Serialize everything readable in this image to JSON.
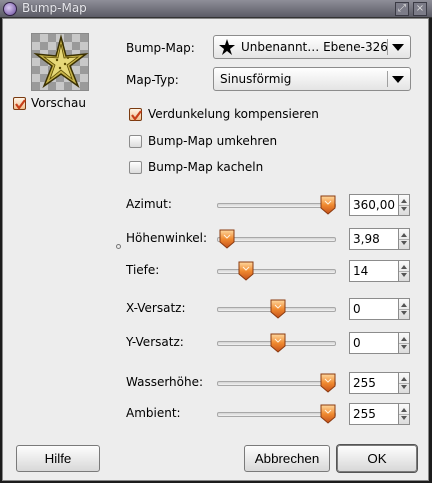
{
  "window": {
    "title": "Bump-Map",
    "accent": "#e8821e"
  },
  "preview": {
    "label": "Vorschau",
    "checked": true
  },
  "bump_map": {
    "label": "Bump-Map:",
    "value": "Unbenannt… Ebene-326"
  },
  "map_type": {
    "label": "Map-Typ:",
    "value": "Sinusförmig"
  },
  "options": [
    {
      "label": "Verdunkelung kompensieren",
      "checked": true
    },
    {
      "label": "Bump-Map umkehren",
      "checked": false
    },
    {
      "label": "Bump-Map kacheln",
      "checked": false
    }
  ],
  "sliders": [
    {
      "label": "Azimut:",
      "value": "360,00",
      "fraction": 1.0
    },
    {
      "label": "Höhenwinkel:",
      "value": "3,98",
      "fraction": 0.0
    },
    {
      "label": "Tiefe:",
      "value": "14",
      "fraction": 0.19
    },
    {
      "label": "X-Versatz:",
      "value": "0",
      "fraction": 0.5
    },
    {
      "label": "Y-Versatz:",
      "value": "0",
      "fraction": 0.5
    },
    {
      "label": "Wasserhöhe:",
      "value": "255",
      "fraction": 1.0
    },
    {
      "label": "Ambient:",
      "value": "255",
      "fraction": 1.0
    }
  ],
  "buttons": {
    "help": "Hilfe",
    "cancel": "Abbrechen",
    "ok": "OK"
  }
}
